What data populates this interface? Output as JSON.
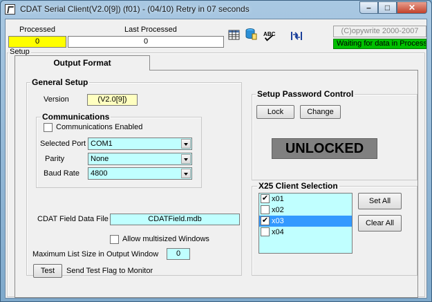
{
  "window": {
    "title": "CDAT Serial Client(V2.0[9]) (f01)  -  (04/10) Retry in 07 seconds",
    "minimize_glyph": "–",
    "maximize_glyph": "□",
    "close_glyph": "✕"
  },
  "header": {
    "processed_label": "Processed",
    "processed_value": "0",
    "last_processed_label": "Last Processed",
    "last_processed_value": "0",
    "copyright": "(C)opywrite 2000-2007",
    "status": "Waiting for data in ProcessIt"
  },
  "toolbar": {
    "icons": [
      "grid-icon",
      "database-icon",
      "spell-check-icon",
      "compress-icon"
    ]
  },
  "setup": {
    "frame_label": "Setup",
    "tab_label": "Output Format"
  },
  "general": {
    "title": "General Setup",
    "version_label": "Version",
    "version_value": "(V2.0[9])",
    "communications": {
      "title": "Communications",
      "enabled_label": "Communications Enabled",
      "enabled": false,
      "port_label": "Selected Port",
      "port_value": "COM1",
      "parity_label": "Parity",
      "parity_value": "None",
      "baud_label": "Baud Rate",
      "baud_value": "4800"
    },
    "field_file_label": "CDAT Field Data File",
    "field_file_value": "CDATField.mdb",
    "multisized_label": "Allow multisized Windows",
    "multisized": false,
    "max_list_label": "Maximum List Size in Output Window",
    "max_list_value": "0",
    "test_button": "Test",
    "test_label": "Send Test Flag to Monitor"
  },
  "password": {
    "title": "Setup Password Control",
    "lock_button": "Lock",
    "change_button": "Change",
    "state": "UNLOCKED"
  },
  "x25": {
    "title": "X25 Client Selection",
    "items": [
      {
        "label": "x01",
        "checked": true,
        "selected": false
      },
      {
        "label": "x02",
        "checked": false,
        "selected": false
      },
      {
        "label": "x03",
        "checked": true,
        "selected": true
      },
      {
        "label": "x04",
        "checked": false,
        "selected": false
      }
    ],
    "set_all": "Set All",
    "clear_all": "Clear All"
  },
  "colors": {
    "processed_bg": "#ffff00",
    "status_bg": "#00c000",
    "input_bg": "#c0ffff",
    "version_bg": "#ffffc0",
    "selection": "#3399ff"
  }
}
